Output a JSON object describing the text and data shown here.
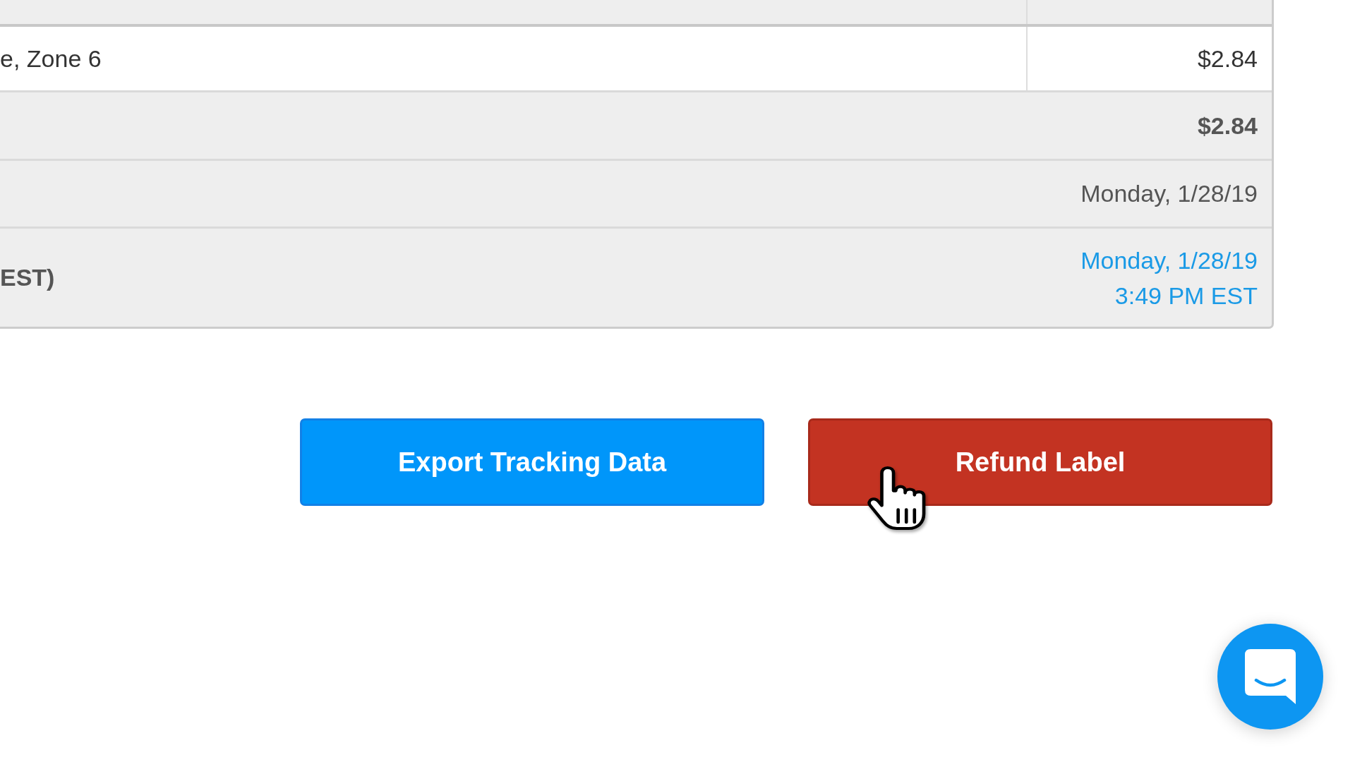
{
  "table": {
    "rows": [
      {
        "kind": "item",
        "label": "e, Zone 6",
        "value": "$2.84"
      },
      {
        "kind": "total",
        "value": "$2.84"
      },
      {
        "kind": "date",
        "value": "Monday, 1/28/19"
      },
      {
        "kind": "link",
        "label": "EST)",
        "value_lines": [
          "Monday, 1/28/19",
          "3:49 PM EST"
        ]
      }
    ]
  },
  "buttons": [
    {
      "kind": "primary",
      "label": "Export Tracking Data"
    },
    {
      "kind": "danger",
      "label": "Refund Label"
    }
  ]
}
